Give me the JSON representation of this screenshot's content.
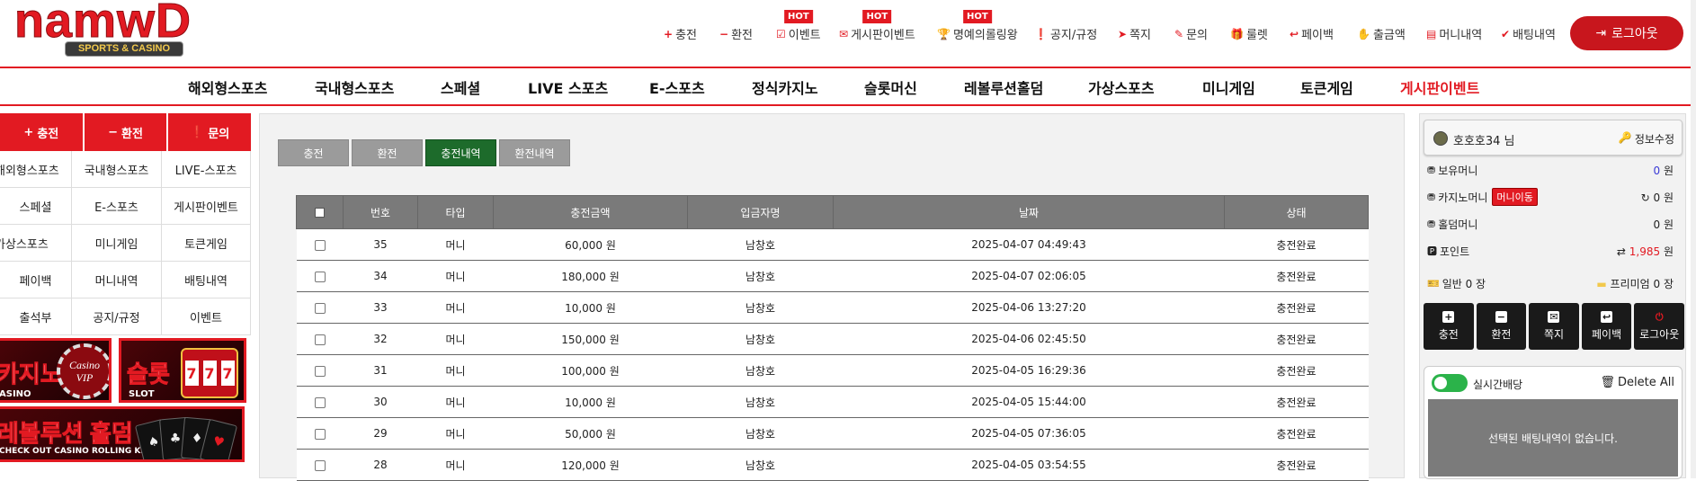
{
  "logo": {
    "main": "namwD",
    "sub": "SPORTS & CASINO"
  },
  "topnav": [
    {
      "label": "충전",
      "icon": "+",
      "hot": ""
    },
    {
      "label": "환전",
      "icon": "−",
      "hot": ""
    },
    {
      "label": "이벤트",
      "icon": "☑",
      "hot": "HOT"
    },
    {
      "label": "게시판이벤트",
      "icon": "✉",
      "hot": "HOT"
    },
    {
      "label": "명예의롤링왕",
      "icon": "🏆",
      "hot": "HOT"
    },
    {
      "label": "공지/규정",
      "icon": "❗",
      "hot": ""
    },
    {
      "label": "쪽지",
      "icon": "➤",
      "hot": ""
    },
    {
      "label": "문의",
      "icon": "✎",
      "hot": ""
    },
    {
      "label": "룰렛",
      "icon": "🎁",
      "hot": ""
    },
    {
      "label": "페이백",
      "icon": "↩",
      "hot": ""
    },
    {
      "label": "출금액",
      "icon": "✋",
      "hot": ""
    },
    {
      "label": "머니내역",
      "icon": "▤",
      "hot": ""
    },
    {
      "label": "배팅내역",
      "icon": "✔",
      "hot": ""
    }
  ],
  "logout_label": "로그아웃",
  "mainnav": [
    "해외형스포츠",
    "국내형스포츠",
    "스페셜",
    "LIVE 스포츠",
    "E-스포츠",
    "정식카지노",
    "슬롯머신",
    "레볼루션홀덤",
    "가상스포츠",
    "미니게임",
    "토큰게임",
    "게시판이벤트"
  ],
  "left_sidebar": {
    "actions": [
      {
        "label": "충전",
        "icon": "+"
      },
      {
        "label": "환전",
        "icon": "−"
      },
      {
        "label": "문의",
        "icon": "❗"
      }
    ],
    "grid": [
      "해외형스포츠",
      "국내형스포츠",
      "LIVE-스포츠",
      "스페셜",
      "E-스포츠",
      "게시판이벤트",
      "가상스포츠",
      "미니게임",
      "토큰게임",
      "페이백",
      "머니내역",
      "배팅내역",
      "출석부",
      "공지/규정",
      "이벤트"
    ],
    "banners": {
      "casino": {
        "title": "카지노",
        "sub": "ASINO",
        "chip": "Casino VIP"
      },
      "slot": {
        "title": "슬롯",
        "sub": "SLOT",
        "reels": [
          "7",
          "7",
          "7"
        ]
      },
      "holdem": {
        "title": "레볼루션 홀덤",
        "sub": "CHECK OUT CASINO ROLLING KING"
      }
    }
  },
  "content": {
    "tabs": [
      {
        "label": "충전",
        "active": false
      },
      {
        "label": "환전",
        "active": false
      },
      {
        "label": "충전내역",
        "active": true
      },
      {
        "label": "환전내역",
        "active": false
      }
    ],
    "columns": [
      "번호",
      "타입",
      "충전금액",
      "입금자명",
      "날짜",
      "상태"
    ],
    "rows": [
      {
        "no": "35",
        "type": "머니",
        "amount": "60,000 원",
        "name": "남창호",
        "date": "2025-04-07 04:49:43",
        "status": "충전완료"
      },
      {
        "no": "34",
        "type": "머니",
        "amount": "180,000 원",
        "name": "남창호",
        "date": "2025-04-07 02:06:05",
        "status": "충전완료"
      },
      {
        "no": "33",
        "type": "머니",
        "amount": "10,000 원",
        "name": "남창호",
        "date": "2025-04-06 13:27:20",
        "status": "충전완료"
      },
      {
        "no": "32",
        "type": "머니",
        "amount": "150,000 원",
        "name": "남창호",
        "date": "2025-04-06 02:45:50",
        "status": "충전완료"
      },
      {
        "no": "31",
        "type": "머니",
        "amount": "100,000 원",
        "name": "남창호",
        "date": "2025-04-05 16:29:36",
        "status": "충전완료"
      },
      {
        "no": "30",
        "type": "머니",
        "amount": "10,000 원",
        "name": "남창호",
        "date": "2025-04-05 15:44:00",
        "status": "충전완료"
      },
      {
        "no": "29",
        "type": "머니",
        "amount": "50,000 원",
        "name": "남창호",
        "date": "2025-04-05 07:36:05",
        "status": "충전완료"
      },
      {
        "no": "28",
        "type": "머니",
        "amount": "120,000 원",
        "name": "남창호",
        "date": "2025-04-05 03:54:55",
        "status": "충전완료"
      }
    ]
  },
  "right_sidebar": {
    "username": "호호호34 님",
    "edit_label": "정보수정",
    "balances": [
      {
        "label": "보유머니",
        "value": "0",
        "unit": "원",
        "color": "blue"
      },
      {
        "label": "카지노머니",
        "value": "0",
        "unit": "원",
        "color": "plain",
        "button": "머니이동"
      },
      {
        "label": "홀덤머니",
        "value": "0",
        "unit": "원",
        "color": "plain"
      },
      {
        "label": "포인트",
        "value": "1,985",
        "unit": "원",
        "color": "red"
      }
    ],
    "tickets": {
      "normal": "일반 0 장",
      "premium": "프리미엄 0 장"
    },
    "quick_buttons": [
      {
        "label": "충전",
        "icon": "+"
      },
      {
        "label": "환전",
        "icon": "−"
      },
      {
        "label": "쪽지",
        "icon": "✉"
      },
      {
        "label": "페이백",
        "icon": "↩"
      },
      {
        "label": "로그아웃",
        "icon": "⏻"
      }
    ],
    "live_bet_label": "실시간배당",
    "delete_all_label": "Delete All",
    "empty_bet_text": "선택된 배팅내역이 없습니다."
  },
  "colors": {
    "accent": "#e21a22",
    "active_tab": "#1d6b2b",
    "table_header": "#7a7a7a",
    "toggle_on": "#2bb34a"
  }
}
